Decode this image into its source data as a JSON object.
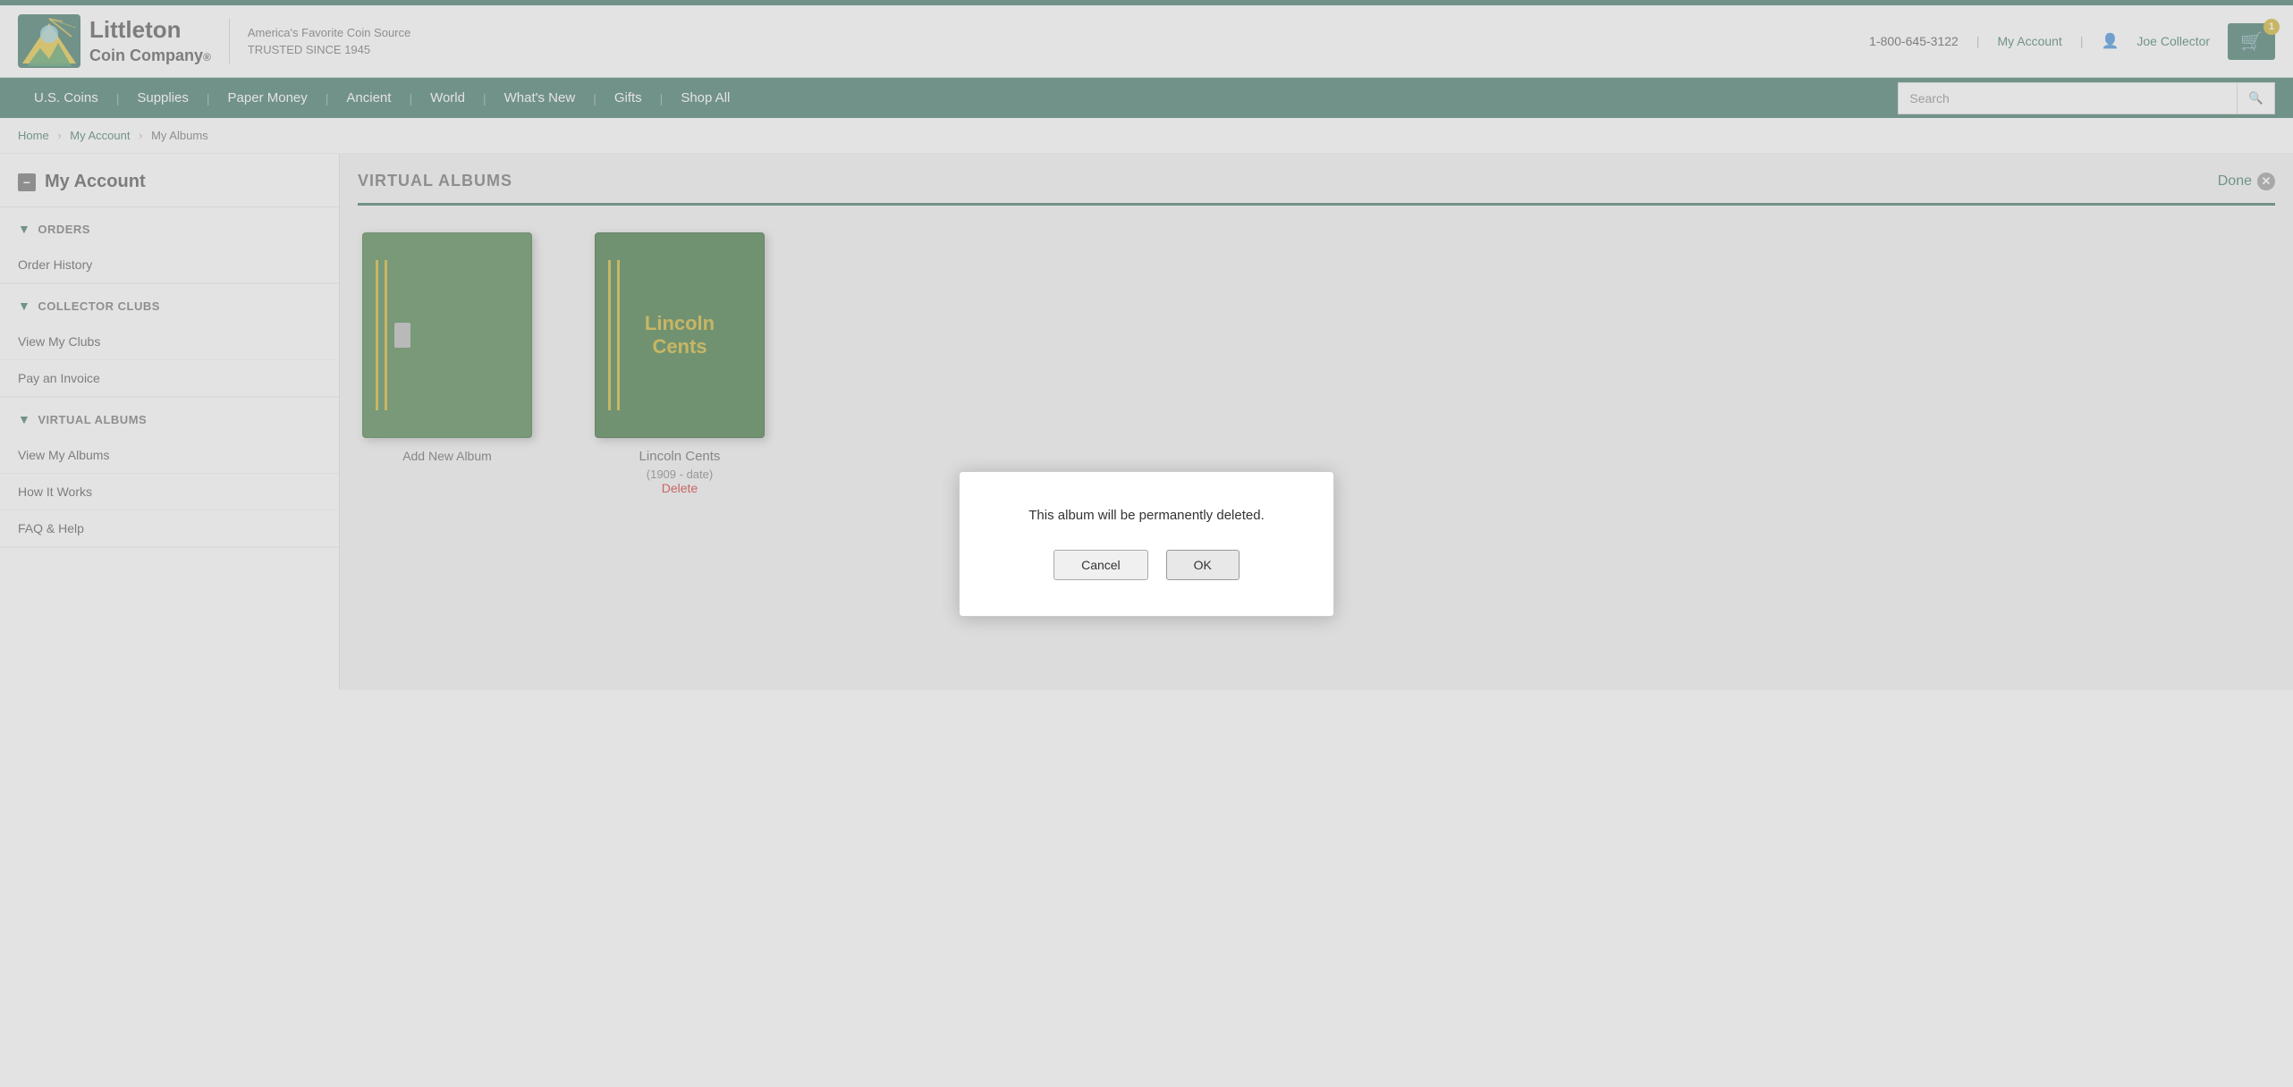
{
  "topbar": {},
  "header": {
    "logo_brand": "Littleton",
    "logo_company": "Coin Company",
    "logo_trademark": "®",
    "tagline_line1": "America's Favorite Coin Source",
    "tagline_line2": "TRUSTED SINCE 1945",
    "phone": "1-800-645-3122",
    "my_account_link": "My Account",
    "user_name": "Joe Collector",
    "cart_count": "1"
  },
  "nav": {
    "items": [
      {
        "label": "U.S. Coins"
      },
      {
        "label": "Supplies"
      },
      {
        "label": "Paper Money"
      },
      {
        "label": "Ancient"
      },
      {
        "label": "World"
      },
      {
        "label": "What's New"
      },
      {
        "label": "Gifts"
      },
      {
        "label": "Shop All"
      }
    ],
    "search_placeholder": "Search"
  },
  "breadcrumb": {
    "home": "Home",
    "my_account": "My Account",
    "current": "My Albums"
  },
  "sidebar": {
    "title": "My Account",
    "sections": [
      {
        "id": "orders",
        "heading": "ORDERS",
        "items": [
          "Order History"
        ]
      },
      {
        "id": "collector-clubs",
        "heading": "COLLECTOR CLUBS",
        "items": [
          "View My Clubs",
          "Pay an Invoice"
        ]
      },
      {
        "id": "virtual-albums",
        "heading": "VIRTUAL ALBUMS",
        "items": [
          "View My Albums",
          "How It Works",
          "FAQ & Help"
        ]
      }
    ]
  },
  "content": {
    "section_title": "VIRTUAL ALBUMS",
    "done_label": "Done",
    "albums": [
      {
        "id": "add-new",
        "label": "Add New Album",
        "type": "add"
      },
      {
        "id": "lincoln-cents",
        "name": "Lincoln Cents",
        "date_range": "(1909 - date)",
        "delete_label": "Delete",
        "type": "existing"
      }
    ]
  },
  "modal": {
    "message": "This album will be permanently deleted.",
    "cancel_label": "Cancel",
    "ok_label": "OK"
  }
}
